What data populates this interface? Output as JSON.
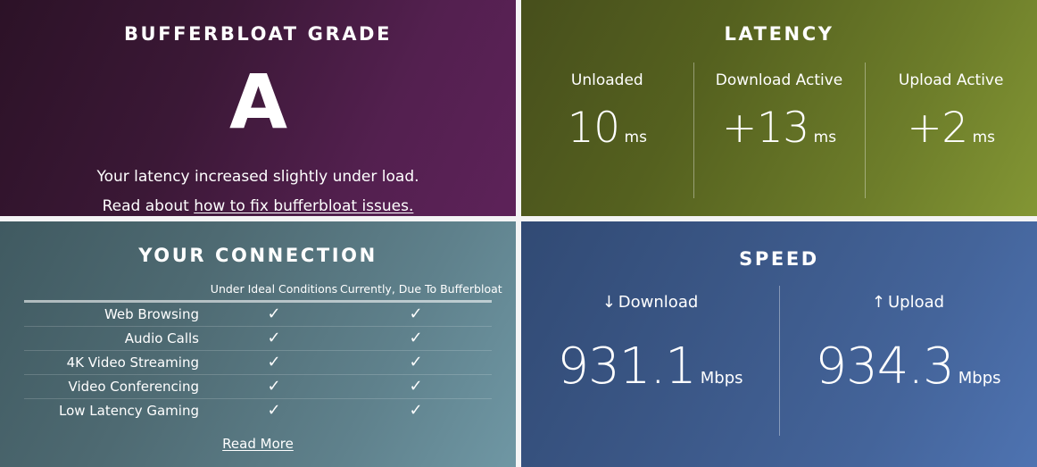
{
  "grade_panel": {
    "title": "BUFFERBLOAT GRADE",
    "grade": "A",
    "summary_line": "Your latency increased slightly under load.",
    "read_about_prefix": "Read about ",
    "fix_link_label": "how to fix bufferbloat issues.",
    "gradient_from": "#2c1227",
    "gradient_to": "#5d2259"
  },
  "latency_panel": {
    "title": "LATENCY",
    "gradient_from": "#474f1c",
    "gradient_to": "#839634",
    "measurements": [
      {
        "label": "Unloaded",
        "value": "10",
        "unit": "ms"
      },
      {
        "label": "Download Active",
        "value": "+13",
        "unit": "ms"
      },
      {
        "label": "Upload Active",
        "value": "+2",
        "unit": "ms"
      }
    ]
  },
  "connection_panel": {
    "title": "YOUR CONNECTION",
    "gradient_from": "#405a61",
    "gradient_to": "#6f97a4",
    "columns": {
      "activity": "",
      "ideal": "Under Ideal Conditions",
      "current": "Currently, Due To Bufferbloat"
    },
    "rows": [
      {
        "activity": "Web Browsing",
        "ideal": "✓",
        "current": "✓"
      },
      {
        "activity": "Audio Calls",
        "ideal": "✓",
        "current": "✓"
      },
      {
        "activity": "4K Video Streaming",
        "ideal": "✓",
        "current": "✓"
      },
      {
        "activity": "Video Conferencing",
        "ideal": "✓",
        "current": "✓"
      },
      {
        "activity": "Low Latency Gaming",
        "ideal": "✓",
        "current": "✓"
      }
    ],
    "read_more_label": "Read More"
  },
  "speed_panel": {
    "title": "SPEED",
    "gradient_from": "#314a74",
    "gradient_to": "#4e73b1",
    "metrics": [
      {
        "arrow": "↓",
        "label": "Download",
        "value": "931.1",
        "unit": "Mbps"
      },
      {
        "arrow": "↑",
        "label": "Upload",
        "value": "934.3",
        "unit": "Mbps"
      }
    ]
  }
}
